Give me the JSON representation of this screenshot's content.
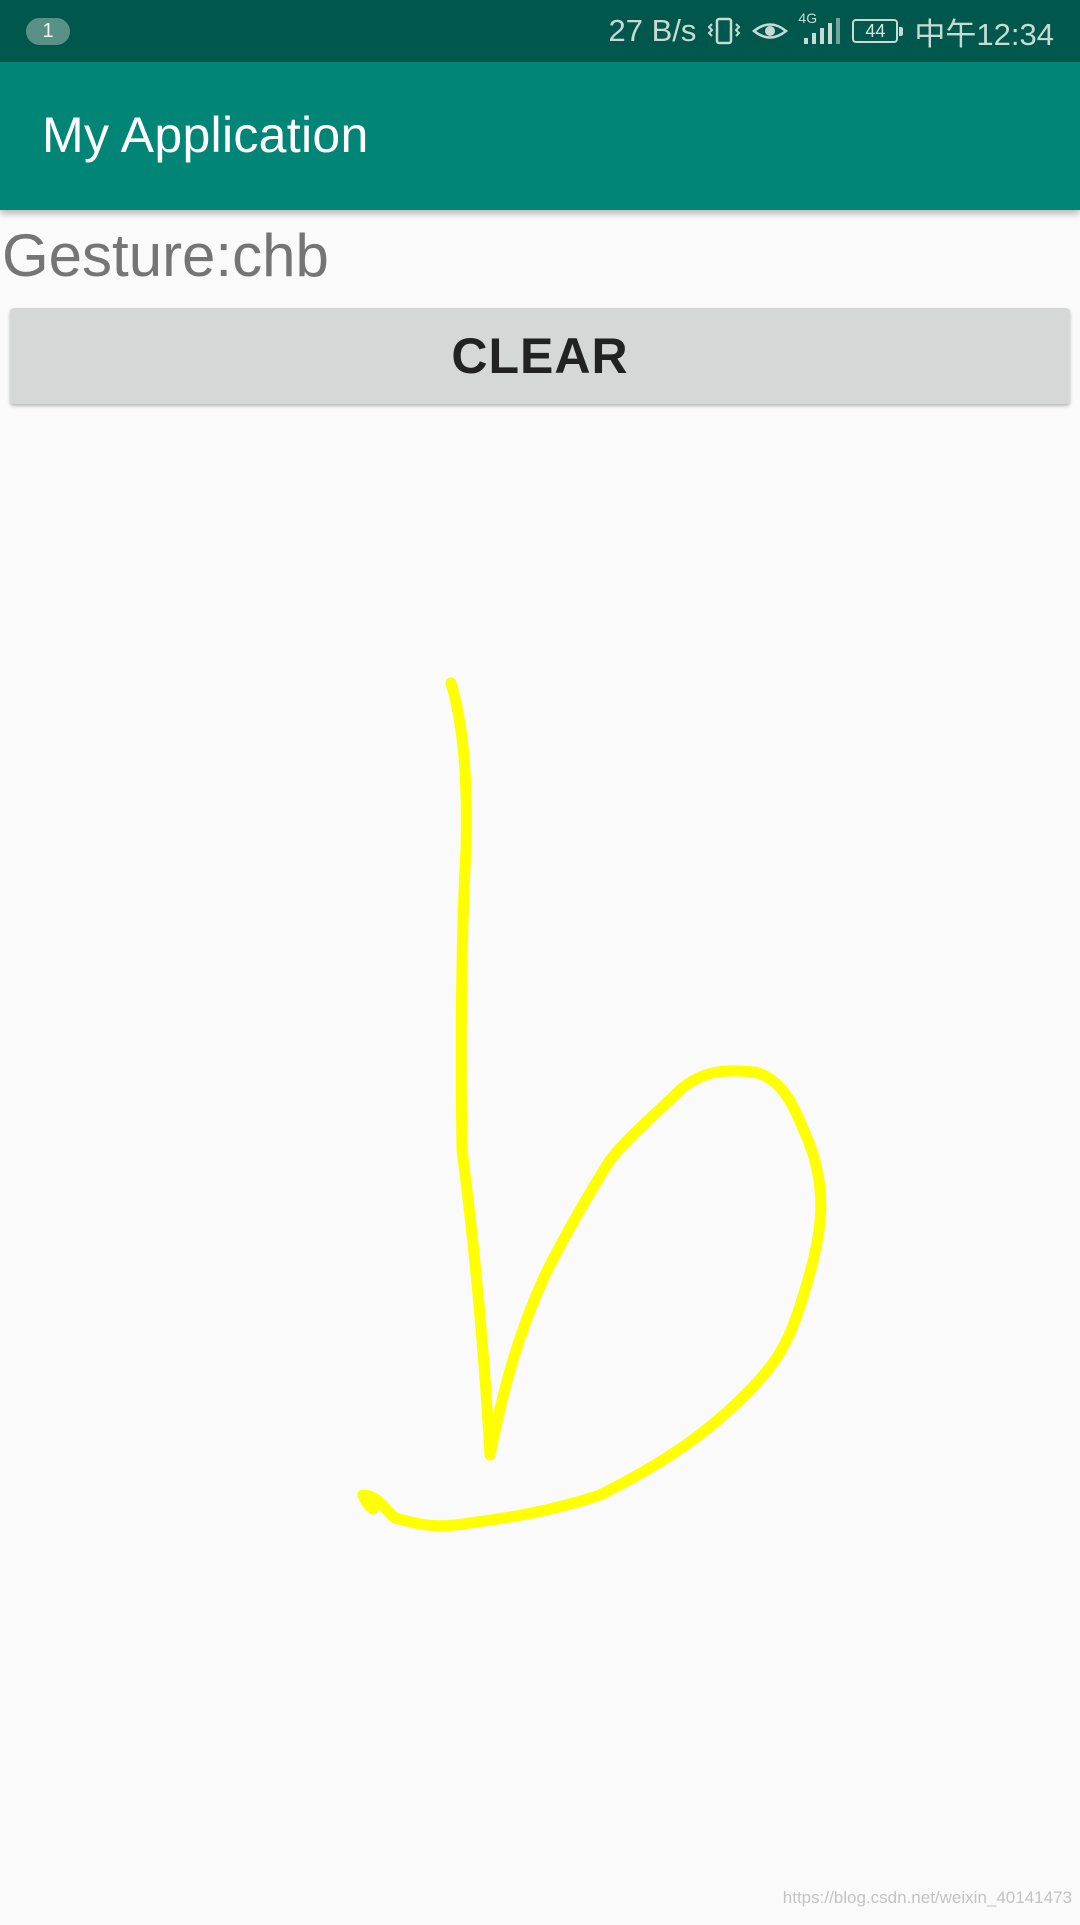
{
  "status_bar": {
    "notification_count": "1",
    "network_speed": "27 B/s",
    "network_type": "4G",
    "battery_level": "44",
    "time": "中午12:34",
    "icons": [
      "vibrate-icon",
      "eye-icon",
      "signal-icon",
      "battery-icon"
    ]
  },
  "app_bar": {
    "title": "My Application",
    "color": "#008577"
  },
  "main": {
    "gesture_label": "Gesture:chb",
    "clear_label": "CLEAR"
  },
  "gesture": {
    "stroke_color": "#ffff00"
  },
  "watermark": "https://blog.csdn.net/weixin_40141473"
}
